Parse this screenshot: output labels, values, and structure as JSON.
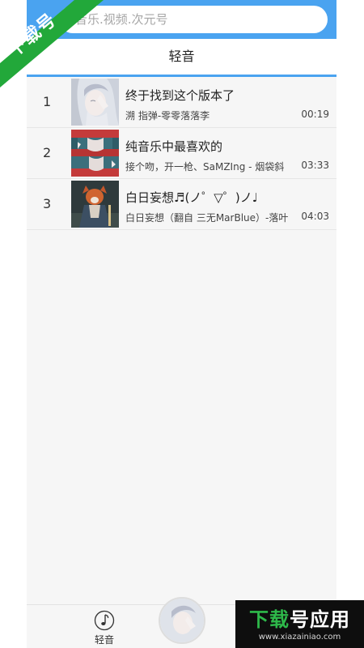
{
  "search": {
    "placeholder": "音乐.视频.次元号"
  },
  "header": {
    "title": "轻音"
  },
  "songs": [
    {
      "index": "1",
      "title": "终于找到这个版本了",
      "subtitle": "溯 指弹-零零落落李",
      "duration": "00:19"
    },
    {
      "index": "2",
      "title": "纯音乐中最喜欢的",
      "subtitle": "接个吻，开一枪、SaMZIng - 烟袋斜",
      "duration": "03:33"
    },
    {
      "index": "3",
      "title": "白日妄想♬(ノ゜▽゜)ノ♩",
      "subtitle": "白日妄想（翻自 三无MarBlue）-落叶",
      "duration": "04:03"
    }
  ],
  "bottom_nav": {
    "tab_label": "轻音",
    "tab_icon": "music-note-icon"
  },
  "watermark": {
    "corner_text": "下载号",
    "brand_text_green": "下载",
    "brand_text_white": "号应用",
    "url": "www.xiazainiao.com"
  },
  "colors": {
    "accent": "#4aa3f0",
    "watermark_green": "#2eb94a"
  }
}
